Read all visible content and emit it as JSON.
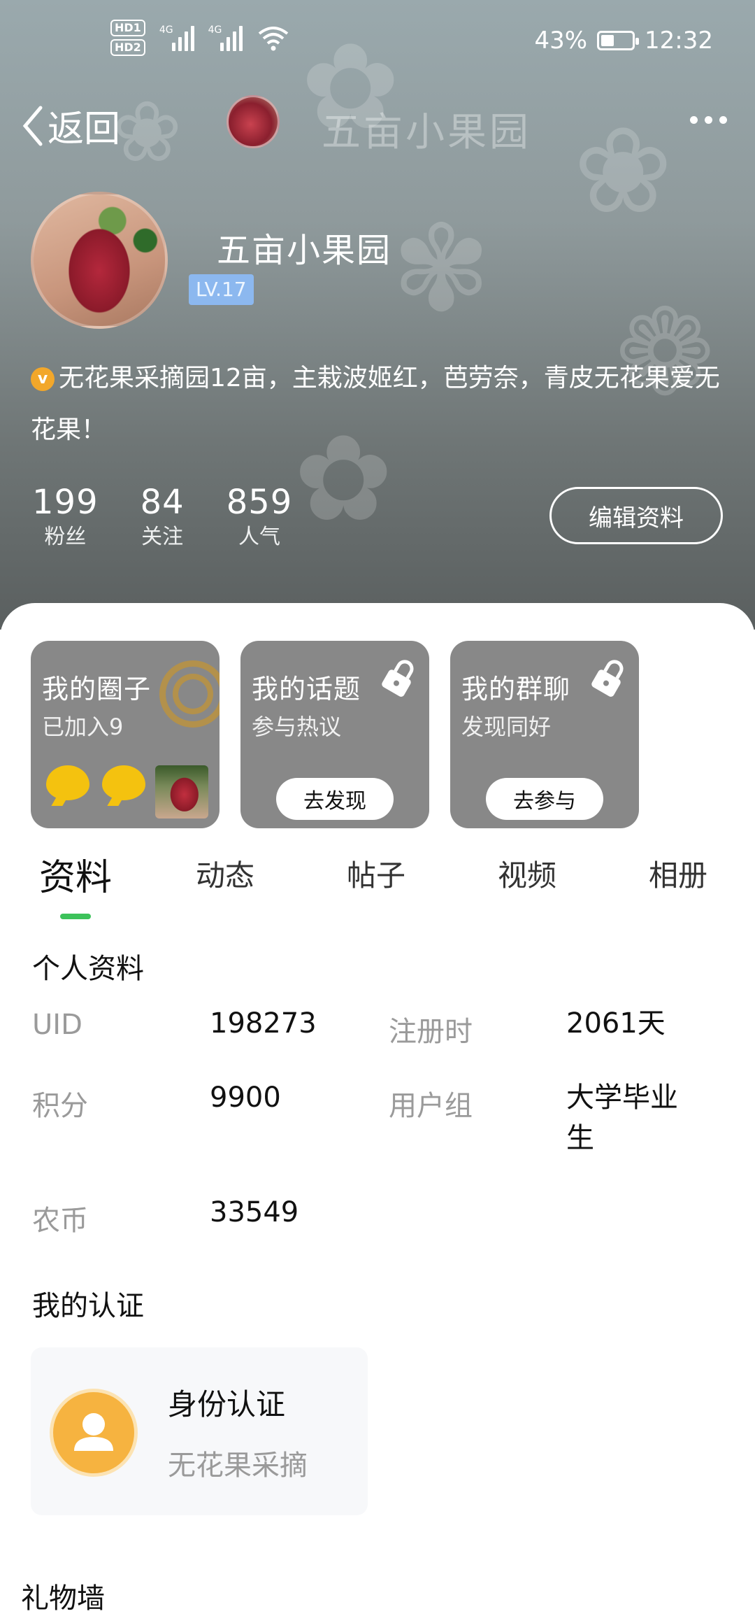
{
  "status_bar": {
    "hd1": "HD1",
    "hd2": "HD2",
    "net1": "4G",
    "net2": "4G",
    "battery_percent": "43%",
    "battery_level": 0.43,
    "time": "12:32"
  },
  "nav": {
    "back_label": "返回",
    "title": "五亩小果园"
  },
  "profile": {
    "name": "五亩小果园",
    "level": "LV.17",
    "verified_badge": "v",
    "bio": "无花果采摘园12亩，主栽波姬红，芭劳奈，青皮无花果爱无花果！",
    "stats": [
      {
        "num": "199",
        "label": "粉丝"
      },
      {
        "num": "84",
        "label": "关注"
      },
      {
        "num": "859",
        "label": "人气"
      }
    ],
    "edit_button": "编辑资料"
  },
  "cards": {
    "circle": {
      "title": "我的圈子",
      "sub": "已加入9"
    },
    "topic": {
      "title": "我的话题",
      "sub": "参与热议",
      "button": "去发现"
    },
    "group": {
      "title": "我的群聊",
      "sub": "发现同好",
      "button": "去参与"
    }
  },
  "tabs": [
    "资料",
    "动态",
    "帖子",
    "视频",
    "相册"
  ],
  "personal": {
    "title": "个人资料",
    "uid_label": "UID",
    "uid_value": "198273",
    "reg_label": "注册时",
    "reg_value": "2061天",
    "points_label": "积分",
    "points_value": "9900",
    "group_label": "用户组",
    "group_value_line1": "大学毕业",
    "group_value_line2": "生",
    "coin_label": "农币",
    "coin_value": "33549"
  },
  "certification": {
    "title": "我的认证",
    "card_title": "身份认证",
    "card_sub": "无花果采摘"
  },
  "gift_wall": {
    "title": "礼物墙"
  },
  "colors": {
    "accent_green": "#3cc25a",
    "level_badge": "#8cb8ef",
    "cert_icon": "#f6b340",
    "card_bg": "#888888"
  }
}
